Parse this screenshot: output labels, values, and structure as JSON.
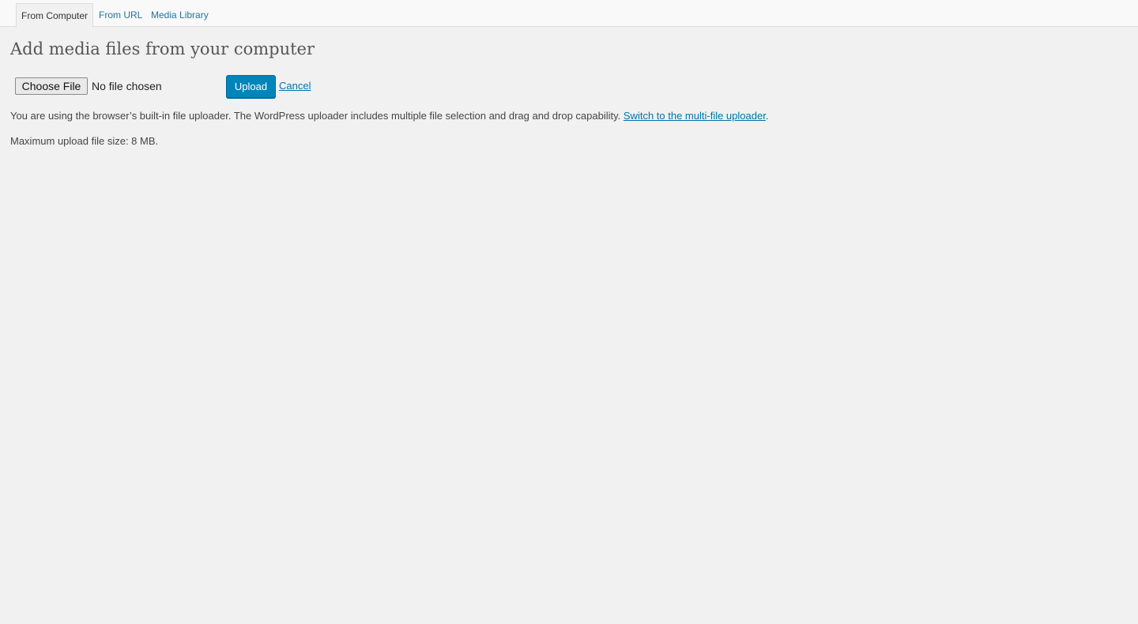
{
  "tabs": [
    {
      "label": "From Computer",
      "active": true
    },
    {
      "label": "From URL",
      "active": false
    },
    {
      "label": "Media Library",
      "active": false
    }
  ],
  "page": {
    "title": "Add media files from your computer"
  },
  "uploader": {
    "choose_file_label": "Choose File",
    "no_file_text": "No file chosen",
    "upload_label": "Upload",
    "cancel_label": "Cancel"
  },
  "info": {
    "browser_uploader_text": "You are using the browser’s built-in file uploader. The WordPress uploader includes multiple file selection and drag and drop capability. ",
    "switch_link": "Switch to the multi-file uploader",
    "period": ".",
    "max_size_text": "Maximum upload file size: 8 MB."
  },
  "colors": {
    "background": "#f1f1f1",
    "link": "#0073aa",
    "primary_button": "#0085ba"
  }
}
